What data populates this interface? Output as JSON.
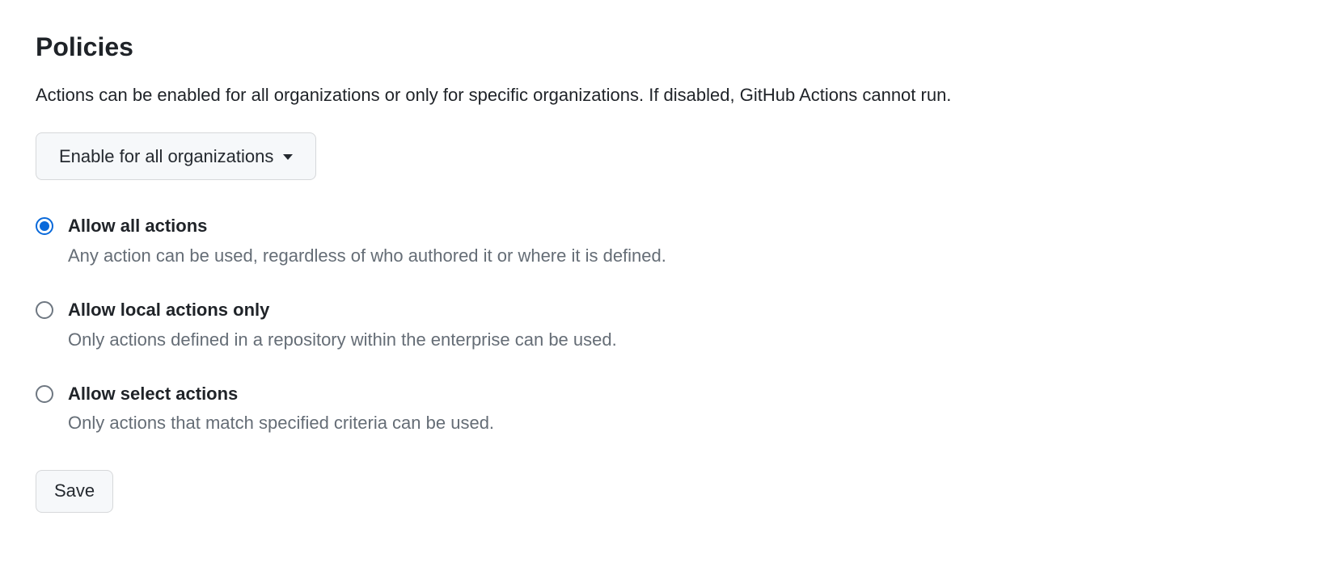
{
  "page": {
    "title": "Policies",
    "description": "Actions can be enabled for all organizations or only for specific organizations. If disabled, GitHub Actions cannot run."
  },
  "scope_dropdown": {
    "selected_label": "Enable for all organizations"
  },
  "policy_options": [
    {
      "label": "Allow all actions",
      "description": "Any action can be used, regardless of who authored it or where it is defined.",
      "checked": true
    },
    {
      "label": "Allow local actions only",
      "description": "Only actions defined in a repository within the enterprise can be used.",
      "checked": false
    },
    {
      "label": "Allow select actions",
      "description": "Only actions that match specified criteria can be used.",
      "checked": false
    }
  ],
  "buttons": {
    "save_label": "Save"
  }
}
